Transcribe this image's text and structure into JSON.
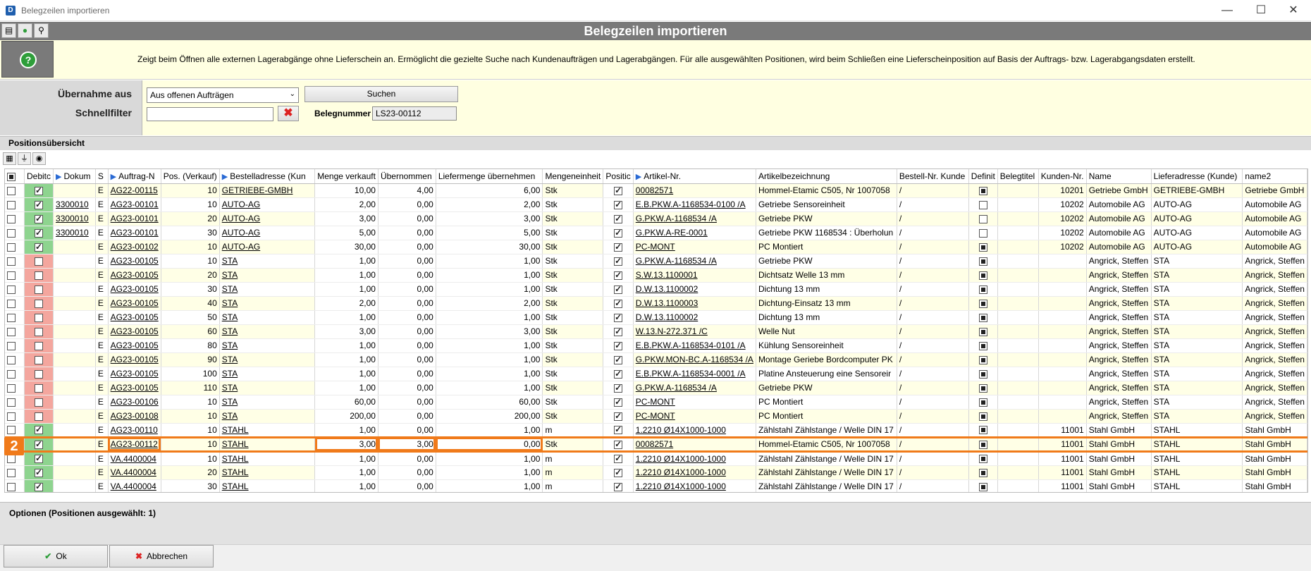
{
  "window": {
    "title": "Belegzeilen importieren",
    "minimize_glyph": "—",
    "maximize_glyph": "☐",
    "close_glyph": "✕"
  },
  "header": {
    "title": "Belegzeilen importieren"
  },
  "info": {
    "text": "Zeigt beim Öffnen alle externen Lagerabgänge ohne Lieferschein an. Ermöglicht die gezielte Suche nach Kundenaufträgen und Lagerabgängen. Für alle ausgewählten Positionen, wird beim Schließen eine Lieferscheinposition auf Basis der Auftrags- bzw. Lagerabgangsdaten erstellt."
  },
  "filter": {
    "uebernahme_label": "Übernahme aus",
    "uebernahme_value": "Aus offenen Aufträgen",
    "search_button": "Suchen",
    "schnellfilter_label": "Schnellfilter",
    "schnellfilter_value": "",
    "belegnummer_label": "Belegnummer",
    "belegnummer_value": "LS23-00112"
  },
  "grid": {
    "section_title": "Positionsübersicht",
    "columns": [
      "",
      "Debitc",
      "Dokum",
      "S",
      "Auftrag-N",
      "Pos. (Verkauf)",
      "Bestelladresse (Kun",
      "Menge verkauft",
      "Übernommen",
      "Liefermenge übernehmen",
      "Mengeneinheit",
      "Positic",
      "Artikel-Nr.",
      "Artikelbezeichnung",
      "Bestell-Nr. Kunde",
      "Definit",
      "Belegtitel",
      "Kunden-Nr.",
      "Name",
      "Lieferadresse (Kunde)",
      "name2"
    ],
    "rows": [
      {
        "deb": "green",
        "debchk": true,
        "dok": "",
        "s": "E",
        "auftrag": "AG22-00115",
        "pos": "10",
        "bestell": "GETRIEBE-GMBH",
        "menge": "10,00",
        "ueb": "4,00",
        "liefer": "6,00",
        "me": "Stk",
        "posc": true,
        "artikel": "00082571",
        "bez": "Hommel-Etamic C505, Nr 1007058",
        "bestnr": "/",
        "def": true,
        "beleg": "",
        "kdnr": "10201",
        "name": "Getriebe GmbH",
        "liefadr": "GETRIEBE-GMBH",
        "name2": "Getriebe GmbH"
      },
      {
        "deb": "green",
        "debchk": true,
        "dok": "3300010",
        "s": "E",
        "auftrag": "AG23-00101",
        "pos": "10",
        "bestell": "AUTO-AG",
        "menge": "2,00",
        "ueb": "0,00",
        "liefer": "2,00",
        "me": "Stk",
        "posc": true,
        "artikel": "E.B.PKW.A-1168534-0100 /A",
        "bez": "Getriebe Sensoreinheit",
        "bestnr": "/",
        "def": false,
        "beleg": "",
        "kdnr": "10202",
        "name": "Automobile AG",
        "liefadr": "AUTO-AG",
        "name2": "Automobile AG"
      },
      {
        "deb": "green",
        "debchk": true,
        "dok": "3300010",
        "s": "E",
        "auftrag": "AG23-00101",
        "pos": "20",
        "bestell": "AUTO-AG",
        "menge": "3,00",
        "ueb": "0,00",
        "liefer": "3,00",
        "me": "Stk",
        "posc": true,
        "artikel": "G.PKW.A-1168534 /A",
        "bez": "Getriebe PKW",
        "bestnr": "/",
        "def": false,
        "beleg": "",
        "kdnr": "10202",
        "name": "Automobile AG",
        "liefadr": "AUTO-AG",
        "name2": "Automobile AG"
      },
      {
        "deb": "green",
        "debchk": true,
        "dok": "3300010",
        "s": "E",
        "auftrag": "AG23-00101",
        "pos": "30",
        "bestell": "AUTO-AG",
        "menge": "5,00",
        "ueb": "0,00",
        "liefer": "5,00",
        "me": "Stk",
        "posc": true,
        "artikel": "G.PKW.A-RE-0001",
        "bez": "Getriebe PKW 1168534 : Überholun",
        "bestnr": "/",
        "def": false,
        "beleg": "",
        "kdnr": "10202",
        "name": "Automobile AG",
        "liefadr": "AUTO-AG",
        "name2": "Automobile AG"
      },
      {
        "deb": "green",
        "debchk": true,
        "dok": "",
        "s": "E",
        "auftrag": "AG23-00102",
        "pos": "10",
        "bestell": "AUTO-AG",
        "menge": "30,00",
        "ueb": "0,00",
        "liefer": "30,00",
        "me": "Stk",
        "posc": true,
        "artikel": "PC-MONT",
        "bez": "PC Montiert",
        "bestnr": "/",
        "def": true,
        "beleg": "",
        "kdnr": "10202",
        "name": "Automobile AG",
        "liefadr": "AUTO-AG",
        "name2": "Automobile AG"
      },
      {
        "deb": "red",
        "debchk": false,
        "dok": "",
        "s": "E",
        "auftrag": "AG23-00105",
        "pos": "10",
        "bestell": "STA",
        "menge": "1,00",
        "ueb": "0,00",
        "liefer": "1,00",
        "me": "Stk",
        "posc": true,
        "artikel": "G.PKW.A-1168534 /A",
        "bez": "Getriebe PKW",
        "bestnr": "/",
        "def": true,
        "beleg": "",
        "kdnr": "",
        "name": "Angrick, Steffen",
        "liefadr": "STA",
        "name2": "Angrick, Steffen"
      },
      {
        "deb": "red",
        "debchk": false,
        "dok": "",
        "s": "E",
        "auftrag": "AG23-00105",
        "pos": "20",
        "bestell": "STA",
        "menge": "1,00",
        "ueb": "0,00",
        "liefer": "1,00",
        "me": "Stk",
        "posc": true,
        "artikel": "S.W.13.1100001",
        "bez": "Dichtsatz Welle 13 mm",
        "bestnr": "/",
        "def": true,
        "beleg": "",
        "kdnr": "",
        "name": "Angrick, Steffen",
        "liefadr": "STA",
        "name2": "Angrick, Steffen"
      },
      {
        "deb": "red",
        "debchk": false,
        "dok": "",
        "s": "E",
        "auftrag": "AG23-00105",
        "pos": "30",
        "bestell": "STA",
        "menge": "1,00",
        "ueb": "0,00",
        "liefer": "1,00",
        "me": "Stk",
        "posc": true,
        "artikel": "D.W.13.1100002",
        "bez": "Dichtung 13 mm",
        "bestnr": "/",
        "def": true,
        "beleg": "",
        "kdnr": "",
        "name": "Angrick, Steffen",
        "liefadr": "STA",
        "name2": "Angrick, Steffen"
      },
      {
        "deb": "red",
        "debchk": false,
        "dok": "",
        "s": "E",
        "auftrag": "AG23-00105",
        "pos": "40",
        "bestell": "STA",
        "menge": "2,00",
        "ueb": "0,00",
        "liefer": "2,00",
        "me": "Stk",
        "posc": true,
        "artikel": "D.W.13.1100003",
        "bez": "Dichtung-Einsatz 13 mm",
        "bestnr": "/",
        "def": true,
        "beleg": "",
        "kdnr": "",
        "name": "Angrick, Steffen",
        "liefadr": "STA",
        "name2": "Angrick, Steffen"
      },
      {
        "deb": "red",
        "debchk": false,
        "dok": "",
        "s": "E",
        "auftrag": "AG23-00105",
        "pos": "50",
        "bestell": "STA",
        "menge": "1,00",
        "ueb": "0,00",
        "liefer": "1,00",
        "me": "Stk",
        "posc": true,
        "artikel": "D.W.13.1100002",
        "bez": "Dichtung 13 mm",
        "bestnr": "/",
        "def": true,
        "beleg": "",
        "kdnr": "",
        "name": "Angrick, Steffen",
        "liefadr": "STA",
        "name2": "Angrick, Steffen"
      },
      {
        "deb": "red",
        "debchk": false,
        "dok": "",
        "s": "E",
        "auftrag": "AG23-00105",
        "pos": "60",
        "bestell": "STA",
        "menge": "3,00",
        "ueb": "0,00",
        "liefer": "3,00",
        "me": "Stk",
        "posc": true,
        "artikel": "W.13.N-272.371 /C",
        "bez": "Welle Nut",
        "bestnr": "/",
        "def": true,
        "beleg": "",
        "kdnr": "",
        "name": "Angrick, Steffen",
        "liefadr": "STA",
        "name2": "Angrick, Steffen"
      },
      {
        "deb": "red",
        "debchk": false,
        "dok": "",
        "s": "E",
        "auftrag": "AG23-00105",
        "pos": "80",
        "bestell": "STA",
        "menge": "1,00",
        "ueb": "0,00",
        "liefer": "1,00",
        "me": "Stk",
        "posc": true,
        "artikel": "E.B.PKW.A-1168534-0101 /A",
        "bez": "Kühlung Sensoreinheit",
        "bestnr": "/",
        "def": true,
        "beleg": "",
        "kdnr": "",
        "name": "Angrick, Steffen",
        "liefadr": "STA",
        "name2": "Angrick, Steffen"
      },
      {
        "deb": "red",
        "debchk": false,
        "dok": "",
        "s": "E",
        "auftrag": "AG23-00105",
        "pos": "90",
        "bestell": "STA",
        "menge": "1,00",
        "ueb": "0,00",
        "liefer": "1,00",
        "me": "Stk",
        "posc": true,
        "artikel": "G.PKW.MON-BC.A-1168534 /A",
        "bez": "Montage Geriebe Bordcomputer PK",
        "bestnr": "/",
        "def": true,
        "beleg": "",
        "kdnr": "",
        "name": "Angrick, Steffen",
        "liefadr": "STA",
        "name2": "Angrick, Steffen"
      },
      {
        "deb": "red",
        "debchk": false,
        "dok": "",
        "s": "E",
        "auftrag": "AG23-00105",
        "pos": "100",
        "bestell": "STA",
        "menge": "1,00",
        "ueb": "0,00",
        "liefer": "1,00",
        "me": "Stk",
        "posc": true,
        "artikel": "E.B.PKW.A-1168534-0001 /A",
        "bez": "Platine Ansteuerung eine Sensoreir",
        "bestnr": "/",
        "def": true,
        "beleg": "",
        "kdnr": "",
        "name": "Angrick, Steffen",
        "liefadr": "STA",
        "name2": "Angrick, Steffen"
      },
      {
        "deb": "red",
        "debchk": false,
        "dok": "",
        "s": "E",
        "auftrag": "AG23-00105",
        "pos": "110",
        "bestell": "STA",
        "menge": "1,00",
        "ueb": "0,00",
        "liefer": "1,00",
        "me": "Stk",
        "posc": true,
        "artikel": "G.PKW.A-1168534 /A",
        "bez": "Getriebe PKW",
        "bestnr": "/",
        "def": true,
        "beleg": "",
        "kdnr": "",
        "name": "Angrick, Steffen",
        "liefadr": "STA",
        "name2": "Angrick, Steffen"
      },
      {
        "deb": "red",
        "debchk": false,
        "dok": "",
        "s": "E",
        "auftrag": "AG23-00106",
        "pos": "10",
        "bestell": "STA",
        "menge": "60,00",
        "ueb": "0,00",
        "liefer": "60,00",
        "me": "Stk",
        "posc": true,
        "artikel": "PC-MONT",
        "bez": "PC Montiert",
        "bestnr": "/",
        "def": true,
        "beleg": "",
        "kdnr": "",
        "name": "Angrick, Steffen",
        "liefadr": "STA",
        "name2": "Angrick, Steffen"
      },
      {
        "deb": "red",
        "debchk": false,
        "dok": "",
        "s": "E",
        "auftrag": "AG23-00108",
        "pos": "10",
        "bestell": "STA",
        "menge": "200,00",
        "ueb": "0,00",
        "liefer": "200,00",
        "me": "Stk",
        "posc": true,
        "artikel": "PC-MONT",
        "bez": "PC Montiert",
        "bestnr": "/",
        "def": true,
        "beleg": "",
        "kdnr": "",
        "name": "Angrick, Steffen",
        "liefadr": "STA",
        "name2": "Angrick, Steffen"
      },
      {
        "deb": "green",
        "debchk": true,
        "dok": "",
        "s": "E",
        "auftrag": "AG23-00110",
        "pos": "10",
        "bestell": "STAHL",
        "menge": "1,00",
        "ueb": "0,00",
        "liefer": "1,00",
        "me": "m",
        "posc": true,
        "artikel": "1.2210 Ø14X1000-1000",
        "bez": "Zählstahl Zählstange / Welle DIN 17",
        "bestnr": "/",
        "def": true,
        "beleg": "",
        "kdnr": "11001",
        "name": "Stahl GmbH",
        "liefadr": "STAHL",
        "name2": "Stahl GmbH"
      },
      {
        "deb": "green",
        "debchk": true,
        "dok": "",
        "s": "E",
        "auftrag": "AG23-00112",
        "pos": "10",
        "bestell": "STAHL",
        "menge": "3,00",
        "ueb": "3,00",
        "liefer": "0,00",
        "me": "Stk",
        "posc": true,
        "artikel": "00082571",
        "bez": "Hommel-Etamic C505, Nr 1007058",
        "bestnr": "/",
        "def": true,
        "beleg": "",
        "kdnr": "11001",
        "name": "Stahl GmbH",
        "liefadr": "STAHL",
        "name2": "Stahl GmbH",
        "selected": true
      },
      {
        "deb": "green",
        "debchk": true,
        "dok": "",
        "s": "E",
        "auftrag": "VA.4400004",
        "pos": "10",
        "bestell": "STAHL",
        "menge": "1,00",
        "ueb": "0,00",
        "liefer": "1,00",
        "me": "m",
        "posc": true,
        "artikel": "1.2210 Ø14X1000-1000",
        "bez": "Zählstahl Zählstange / Welle DIN 17",
        "bestnr": "/",
        "def": true,
        "beleg": "",
        "kdnr": "11001",
        "name": "Stahl GmbH",
        "liefadr": "STAHL",
        "name2": "Stahl GmbH"
      },
      {
        "deb": "green",
        "debchk": true,
        "dok": "",
        "s": "E",
        "auftrag": "VA.4400004",
        "pos": "20",
        "bestell": "STAHL",
        "menge": "1,00",
        "ueb": "0,00",
        "liefer": "1,00",
        "me": "m",
        "posc": true,
        "artikel": "1.2210 Ø14X1000-1000",
        "bez": "Zählstahl Zählstange / Welle DIN 17",
        "bestnr": "/",
        "def": true,
        "beleg": "",
        "kdnr": "11001",
        "name": "Stahl GmbH",
        "liefadr": "STAHL",
        "name2": "Stahl GmbH"
      },
      {
        "deb": "green",
        "debchk": true,
        "dok": "",
        "s": "E",
        "auftrag": "VA.4400004",
        "pos": "30",
        "bestell": "STAHL",
        "menge": "1,00",
        "ueb": "0,00",
        "liefer": "1,00",
        "me": "m",
        "posc": true,
        "artikel": "1.2210 Ø14X1000-1000",
        "bez": "Zählstahl Zählstange / Welle DIN 17",
        "bestnr": "/",
        "def": true,
        "beleg": "",
        "kdnr": "11001",
        "name": "Stahl GmbH",
        "liefadr": "STAHL",
        "name2": "Stahl GmbH"
      }
    ],
    "selection_badge": "2"
  },
  "options": {
    "title": "Optionen (Positionen ausgewählt: 1)"
  },
  "footer": {
    "ok_label": "Ok",
    "cancel_label": "Abbrechen"
  },
  "colors": {
    "highlight": "#f07a1a",
    "green": "#8ed48f",
    "red": "#f4a69e",
    "row_yellow": "#ffffe6"
  }
}
